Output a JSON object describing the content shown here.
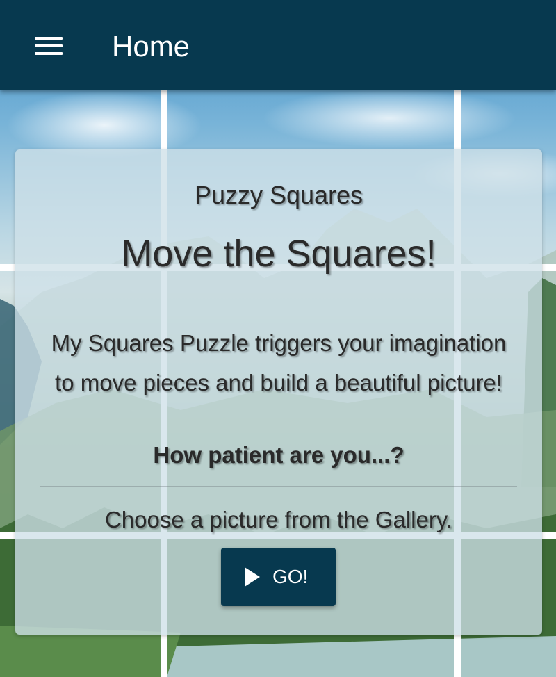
{
  "appbar": {
    "menu_icon": "hamburger-menu-icon",
    "title": "Home",
    "color": "#07394f"
  },
  "card": {
    "subtitle": "Puzzy Squares",
    "headline": "Move the Squares!",
    "description": "My Squares Puzzle triggers your imagination to move pieces and build a beautiful picture!",
    "question": "How patient are you...?",
    "instruction": "Choose a picture from the Gallery.",
    "go_button": {
      "icon": "play-icon",
      "label": "GO!"
    }
  }
}
